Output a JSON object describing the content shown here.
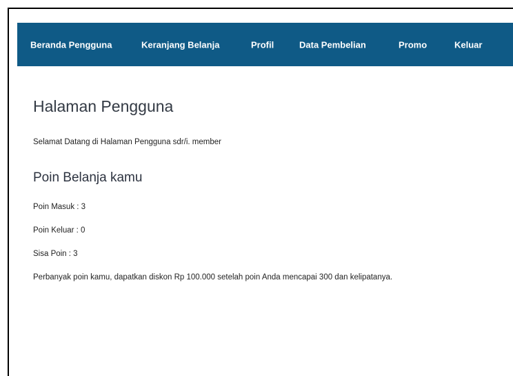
{
  "navbar": {
    "items": [
      {
        "label": "Beranda Pengguna"
      },
      {
        "label": "Keranjang Belanja"
      },
      {
        "label": "Profil"
      },
      {
        "label": "Data Pembelian"
      },
      {
        "label": "Promo"
      },
      {
        "label": "Keluar"
      }
    ],
    "background_color": "#0f5a86",
    "text_color": "#ffffff"
  },
  "main": {
    "title": "Halaman Pengguna",
    "welcome_text": "Selamat Datang di Halaman Pengguna sdr/i. member",
    "points_section": {
      "title": "Poin Belanja kamu",
      "points_in": "Poin Masuk : 3",
      "points_out": "Poin Keluar : 0",
      "points_remaining": "Sisa Poin : 3",
      "promo_note": "Perbanyak poin kamu, dapatkan diskon Rp 100.000 setelah poin Anda mencapai 300 dan kelipatanya."
    }
  }
}
